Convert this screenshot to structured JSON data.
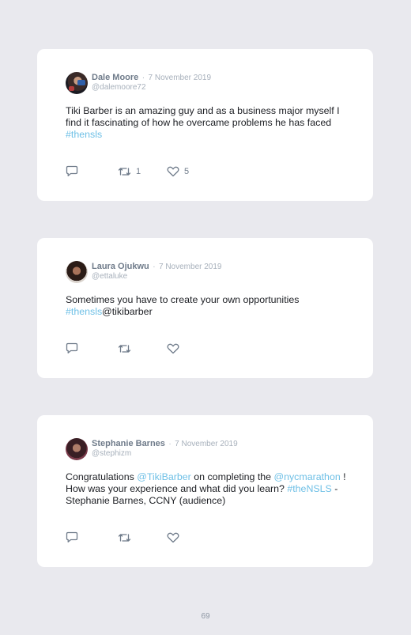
{
  "tweets": [
    {
      "name": "Dale Moore",
      "separator": "·",
      "date": "7 November 2019",
      "handle": "@dalemoore72",
      "text_1": "Tiki Barber is an amazing guy and as a business major myself I find it fascinating of how he overcame problems he has faced ",
      "tag_1": "#thensls",
      "retweet_count": "1",
      "like_count": "5"
    },
    {
      "name": "Laura Ojukwu",
      "separator": "·",
      "date": "7 November 2019",
      "handle": "@ettaluke",
      "text_1": "Sometimes you have to create your own opportunities ",
      "tag_1": "#thensls",
      "text_2": "@tikibarber"
    },
    {
      "name": "Stephanie Barnes",
      "separator": "·",
      "date": "7 November 2019",
      "handle": "@stephizm",
      "text_1": "Congratulations ",
      "tag_1": "@TikiBarber",
      "text_2": " on completing the ",
      "tag_2": "@nycmarathon",
      "text_3": " ! How was your experience and what did you learn? ",
      "tag_3": "#theNSLS",
      "text_4": " -Stephanie Barnes, CCNY (audience)"
    }
  ],
  "page_number": "69",
  "colors": {
    "background": "#e9e9ee",
    "card": "#ffffff",
    "hashtag": "#6fc0e6",
    "muted": "#a7b0bb",
    "name": "#6f7b8a"
  },
  "icons": [
    "reply-icon",
    "retweet-icon",
    "like-icon"
  ]
}
